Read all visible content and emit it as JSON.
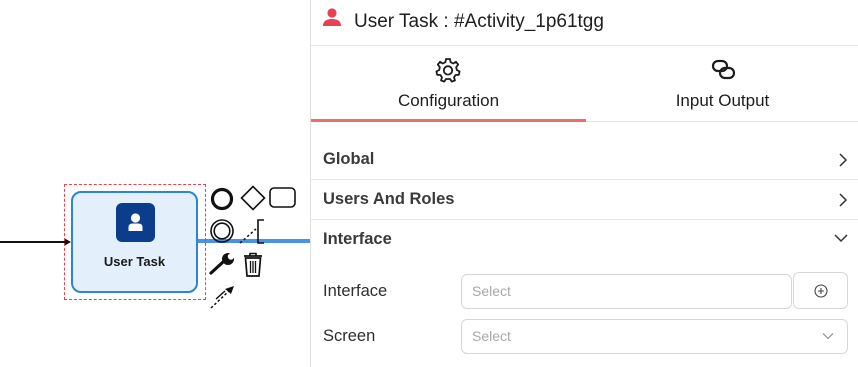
{
  "canvas": {
    "task": {
      "label": "User Task",
      "icon": "user-icon"
    },
    "context_pad": [
      {
        "name": "end-event-icon"
      },
      {
        "name": "gateway-icon"
      },
      {
        "name": "task-icon"
      },
      {
        "name": "intermediate-event-icon"
      },
      {
        "name": "text-annotation-icon"
      },
      {
        "name": "change-type-icon"
      },
      {
        "name": "delete-icon"
      },
      {
        "name": "connect-icon"
      }
    ],
    "colors": {
      "task_fill": "#e3f0fc",
      "task_border": "#2a85d6",
      "icon_bg": "#0b3d8c",
      "selection": "#e8414f",
      "connection": "#4a93e4"
    }
  },
  "panel": {
    "title": "User Task : #Activity_1p61tgg",
    "title_icon": "user-icon",
    "tabs": [
      {
        "label": "Configuration",
        "icon": "gear-icon",
        "active": true
      },
      {
        "label": "Input Output",
        "icon": "link-icon",
        "active": false
      }
    ],
    "sections": [
      {
        "title": "Global",
        "expanded": false
      },
      {
        "title": "Users And Roles",
        "expanded": false
      },
      {
        "title": "Interface",
        "expanded": true
      }
    ],
    "fields": {
      "interface": {
        "label": "Interface",
        "placeholder": "Select",
        "add_icon": "plus-circle-icon"
      },
      "screen": {
        "label": "Screen",
        "placeholder": "Select"
      }
    },
    "colors": {
      "accent": "#e8706a",
      "title_icon": "#e8414f"
    }
  }
}
